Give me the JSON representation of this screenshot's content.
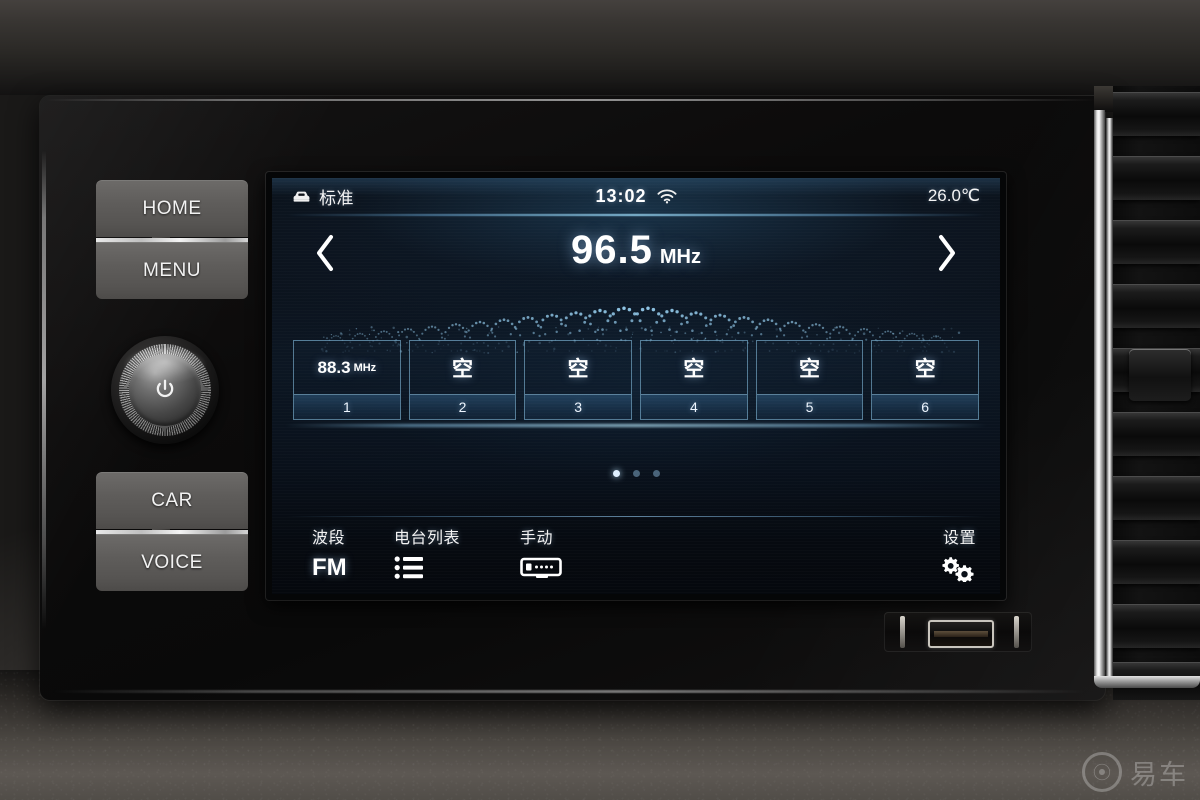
{
  "device": {
    "name": "car-infotainment-head-unit",
    "hard_buttons": [
      {
        "id": "home",
        "label": "HOME"
      },
      {
        "id": "menu",
        "label": "MENU"
      },
      {
        "id": "car",
        "label": "CAR"
      },
      {
        "id": "voice",
        "label": "VOICE"
      }
    ],
    "knob": {
      "name": "power-volume-knob",
      "icon": "power-icon"
    },
    "usb_port": {
      "name": "usb-port"
    }
  },
  "screen": {
    "status_bar": {
      "profile_icon": "car-profile-icon",
      "profile_label": "标准",
      "time": "13:02",
      "wifi_icon": "wifi-icon",
      "temperature": "26.0",
      "temperature_unit": "℃"
    },
    "tuner": {
      "prev_icon": "chevron-left-icon",
      "next_icon": "chevron-right-icon",
      "frequency": "96.5",
      "frequency_unit": "MHz"
    },
    "presets": [
      {
        "index": "1",
        "value": "88.3",
        "unit": "MHz",
        "empty": false
      },
      {
        "index": "2",
        "value": "空",
        "unit": "",
        "empty": true
      },
      {
        "index": "3",
        "value": "空",
        "unit": "",
        "empty": true
      },
      {
        "index": "4",
        "value": "空",
        "unit": "",
        "empty": true
      },
      {
        "index": "5",
        "value": "空",
        "unit": "",
        "empty": true
      },
      {
        "index": "6",
        "value": "空",
        "unit": "",
        "empty": true
      }
    ],
    "pagination": {
      "total": 3,
      "active": 1
    },
    "toolbar": {
      "band": {
        "label": "波段",
        "value": "FM"
      },
      "station_list": {
        "label": "电台列表",
        "icon": "list-icon"
      },
      "manual": {
        "label": "手动",
        "icon": "manual-tuner-icon"
      },
      "settings": {
        "label": "设置",
        "icon": "gears-icon"
      }
    },
    "colors": {
      "accent": "#9ad3f5",
      "screen_bg": "#0a1018",
      "text": "#ffffff",
      "preset_border": "#8cc8eb"
    }
  },
  "watermark": {
    "text": "易车",
    "logo_icon": "yiche-logo-icon"
  }
}
